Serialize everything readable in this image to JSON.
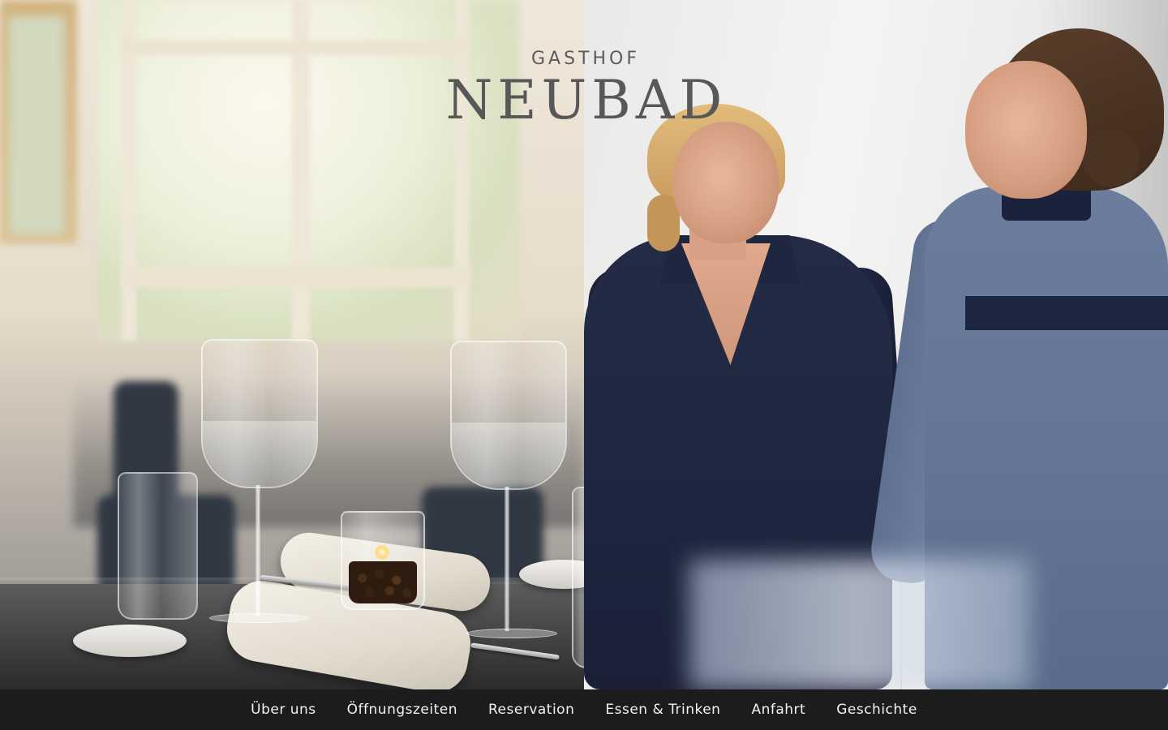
{
  "brand": {
    "top_line": "GASTHOF",
    "name": "NEUBAD"
  },
  "hero": {
    "left_photo": "restaurant-table-photo",
    "right_photo": "staff-photo"
  },
  "nav": {
    "items": [
      {
        "label": "Über uns"
      },
      {
        "label": "Öffnungszeiten"
      },
      {
        "label": "Reservation"
      },
      {
        "label": "Essen & Trinken"
      },
      {
        "label": "Anfahrt"
      },
      {
        "label": "Geschichte"
      }
    ]
  },
  "colors": {
    "nav_background": "#1c1c1c",
    "nav_text": "#f2f2f2",
    "logo_text": "#5c5c5c"
  }
}
